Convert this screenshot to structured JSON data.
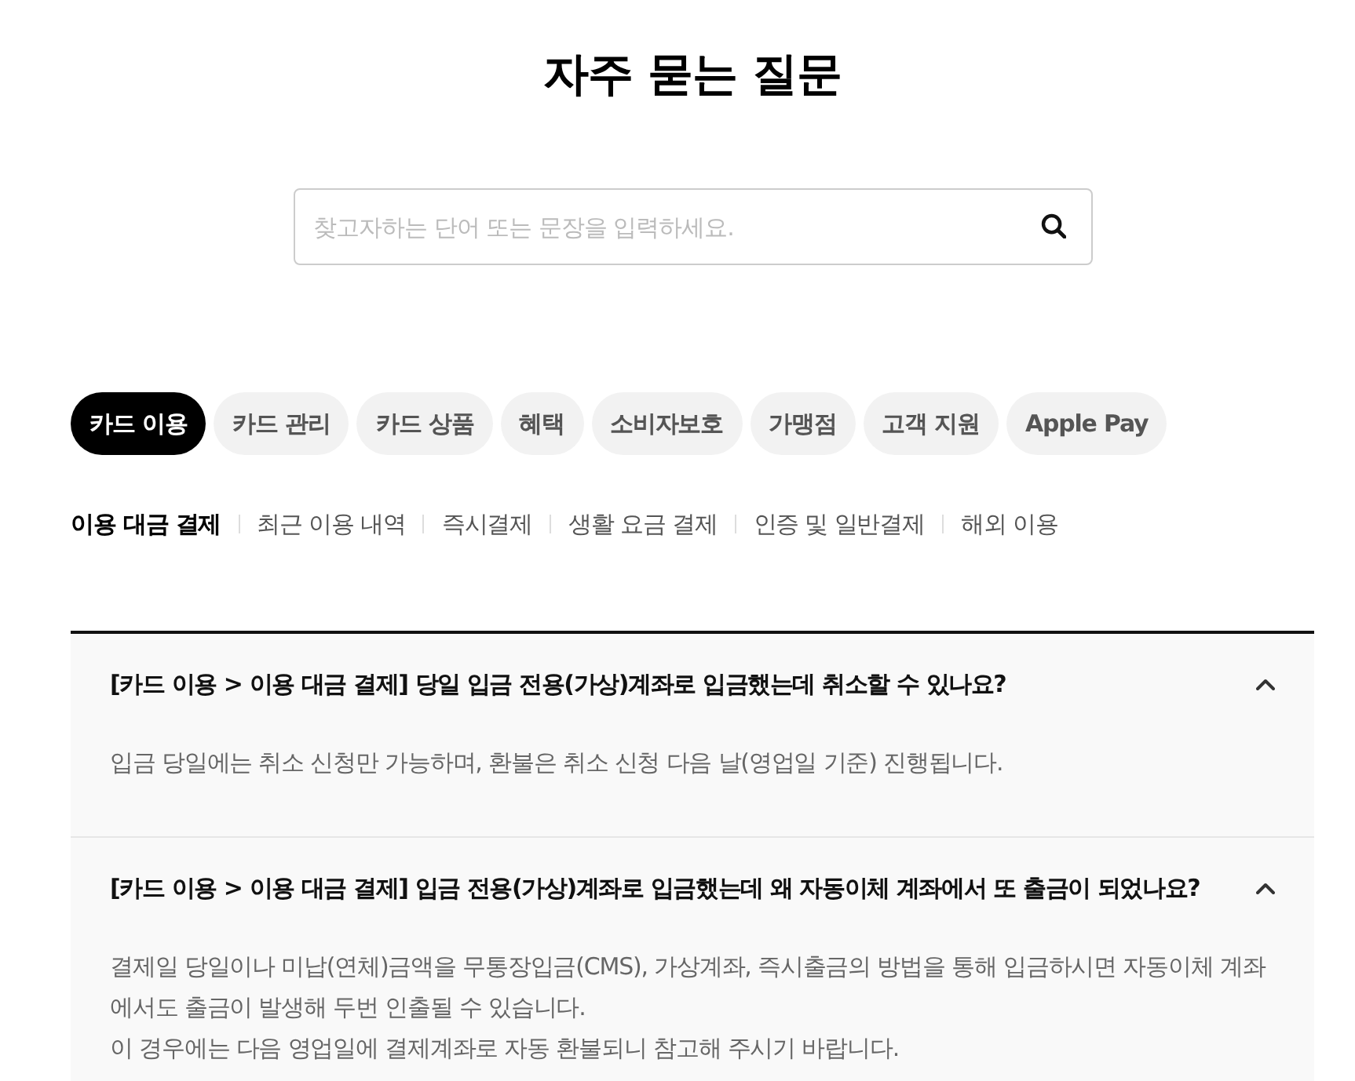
{
  "title": "자주 묻는 질문",
  "search": {
    "placeholder": "찾고자하는 단어 또는 문장을 입력하세요."
  },
  "categories": [
    {
      "label": "카드 이용",
      "selected": true
    },
    {
      "label": "카드 관리",
      "selected": false
    },
    {
      "label": "카드 상품",
      "selected": false
    },
    {
      "label": "혜택",
      "selected": false
    },
    {
      "label": "소비자보호",
      "selected": false
    },
    {
      "label": "가맹점",
      "selected": false
    },
    {
      "label": "고객 지원",
      "selected": false
    },
    {
      "label": "Apple Pay",
      "selected": false
    }
  ],
  "subcategories": [
    {
      "label": "이용 대금 결제",
      "selected": true
    },
    {
      "label": "최근 이용 내역",
      "selected": false
    },
    {
      "label": "즉시결제",
      "selected": false
    },
    {
      "label": "생활 요금 결제",
      "selected": false
    },
    {
      "label": "인증 및 일반결제",
      "selected": false
    },
    {
      "label": "해외 이용",
      "selected": false
    }
  ],
  "faqs": [
    {
      "question": "[카드 이용 > 이용 대금 결제] 당일 입금 전용(가상)계좌로 입금했는데 취소할 수 있나요?",
      "expanded": true,
      "answer": [
        "입금 당일에는 취소 신청만 가능하며, 환불은 취소 신청 다음 날(영업일 기준) 진행됩니다."
      ]
    },
    {
      "question": "[카드 이용 > 이용 대금 결제] 입금 전용(가상)계좌로 입금했는데 왜 자동이체 계좌에서 또 출금이 되었나요?",
      "expanded": true,
      "answer": [
        "결제일 당일이나 미납(연체)금액을 무통장입금(CMS), 가상계좌, 즉시출금의 방법을 통해 입금하시면 자동이체 계좌에서도 출금이 발생해 두번 인출될 수 있습니다.",
        "이 경우에는 다음 영업일에 결제계좌로 자동 환불되니 참고해 주시기 바랍니다."
      ]
    }
  ]
}
